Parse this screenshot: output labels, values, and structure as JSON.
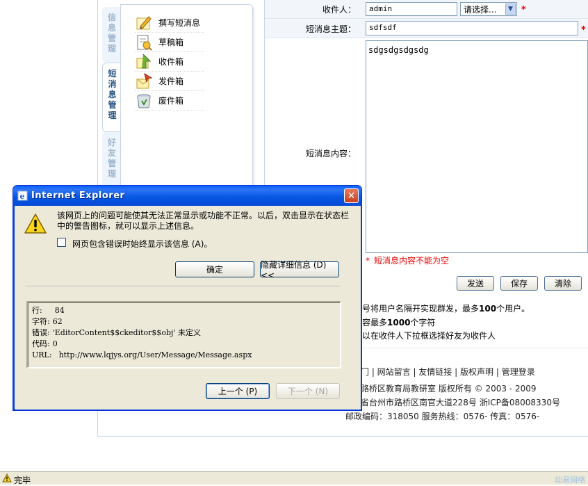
{
  "sidebar": {
    "tabs": [
      {
        "id": "info",
        "label": "信息管理"
      },
      {
        "id": "sms",
        "label": "短消息管理"
      },
      {
        "id": "friend",
        "label": "好友管理"
      }
    ],
    "menu": [
      {
        "label": "撰写短消息",
        "icon": "compose-icon"
      },
      {
        "label": "草稿箱",
        "icon": "draft-icon"
      },
      {
        "label": "收件箱",
        "icon": "inbox-icon"
      },
      {
        "label": "发件箱",
        "icon": "outbox-icon"
      },
      {
        "label": "废件箱",
        "icon": "trash-icon"
      }
    ]
  },
  "form": {
    "recipient_label": "收件人：",
    "recipient_value": "admin",
    "select_label": "请选择...",
    "subject_label": "短消息主题：",
    "subject_value": "sdfsdf",
    "content_label": "短消息内容：",
    "content_value": "sdgsdgsdgsdg",
    "error": "短消息内容不能为空",
    "required_mark": "*",
    "send_label": "发送",
    "save_label": "保存",
    "clear_label": "清除",
    "tips": [
      {
        "pre": "号将用户名隔开实现群发，最多",
        "bold": "100",
        "post": "个用户。"
      },
      {
        "pre": "容最多",
        "bold": "1000",
        "post": "个字符"
      },
      {
        "pre": "以在收件人下拉框选择好友为收件人",
        "bold": "",
        "post": ""
      }
    ]
  },
  "footer": {
    "links": "门 | 网站留言 | 友情链接 | 版权声明 | 管理登录",
    "copyright": "路桥区教育局教研室 版权所有 © 2003 - 2009",
    "address": "省台州市路桥区南官大道228号 浙ICP备08008330号",
    "contact": "邮政编码：318050 服务热线：0576- 传真：0576-"
  },
  "statusbar": {
    "text": "完毕",
    "watermark": "动易网络"
  },
  "dialog": {
    "title": "Internet Explorer",
    "message": "该网页上的问题可能使其无法正常显示或功能不正常。以后，双击显示在状态栏中的警告图标，就可以显示上述信息。",
    "checkbox_label": "网页包含错误时始终显示该信息 (A)。",
    "ok_label": "确定",
    "hide_details_label": "隐藏详细信息 (D) <<",
    "details": [
      {
        "key": "行:",
        "value": "84"
      },
      {
        "key": "字符:",
        "value": "62"
      },
      {
        "key": "错误:",
        "value": "'EditorContent$$ckeditor$$obj' 未定义"
      },
      {
        "key": "代码:",
        "value": "0"
      },
      {
        "key": "URL:",
        "value": "http://www.lqjys.org/User/Message/Message.aspx"
      }
    ],
    "prev_label": "上一个 (P)",
    "next_label": "下一个 (N)"
  }
}
